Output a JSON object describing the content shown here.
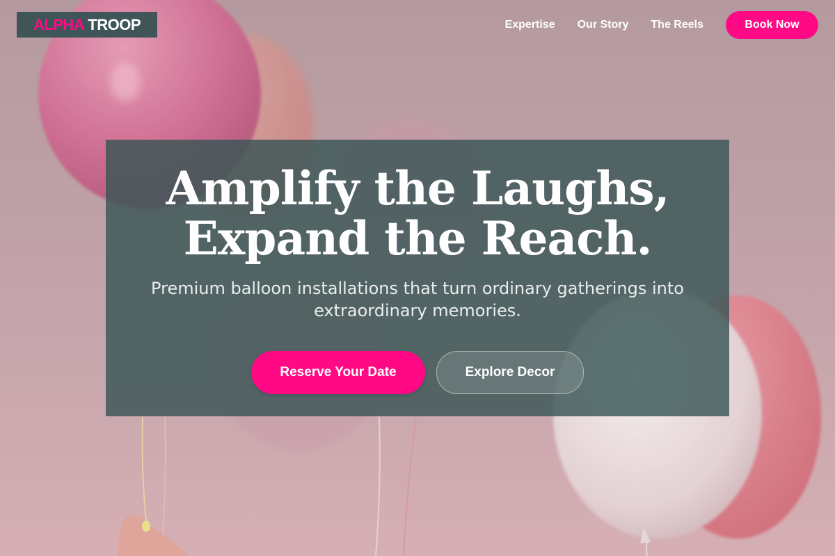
{
  "brand": {
    "logo_part1": "ALPHA",
    "logo_part2": "TROOP",
    "colors": {
      "accent": "#ff0a84",
      "logo_bg": "#3f5558",
      "card_bg": "#395555"
    }
  },
  "nav": {
    "items": [
      {
        "label": "Expertise"
      },
      {
        "label": "Our Story"
      },
      {
        "label": "The Reels"
      }
    ],
    "cta_label": "Book Now"
  },
  "hero": {
    "title_line1": "Amplify the Laughs,",
    "title_line2": "Expand the Reach.",
    "subtitle": "Premium balloon installations that turn ordinary gatherings into extraordinary memories.",
    "primary_button": "Reserve Your Date",
    "secondary_button": "Explore Decor",
    "background": "balloons-photo"
  }
}
